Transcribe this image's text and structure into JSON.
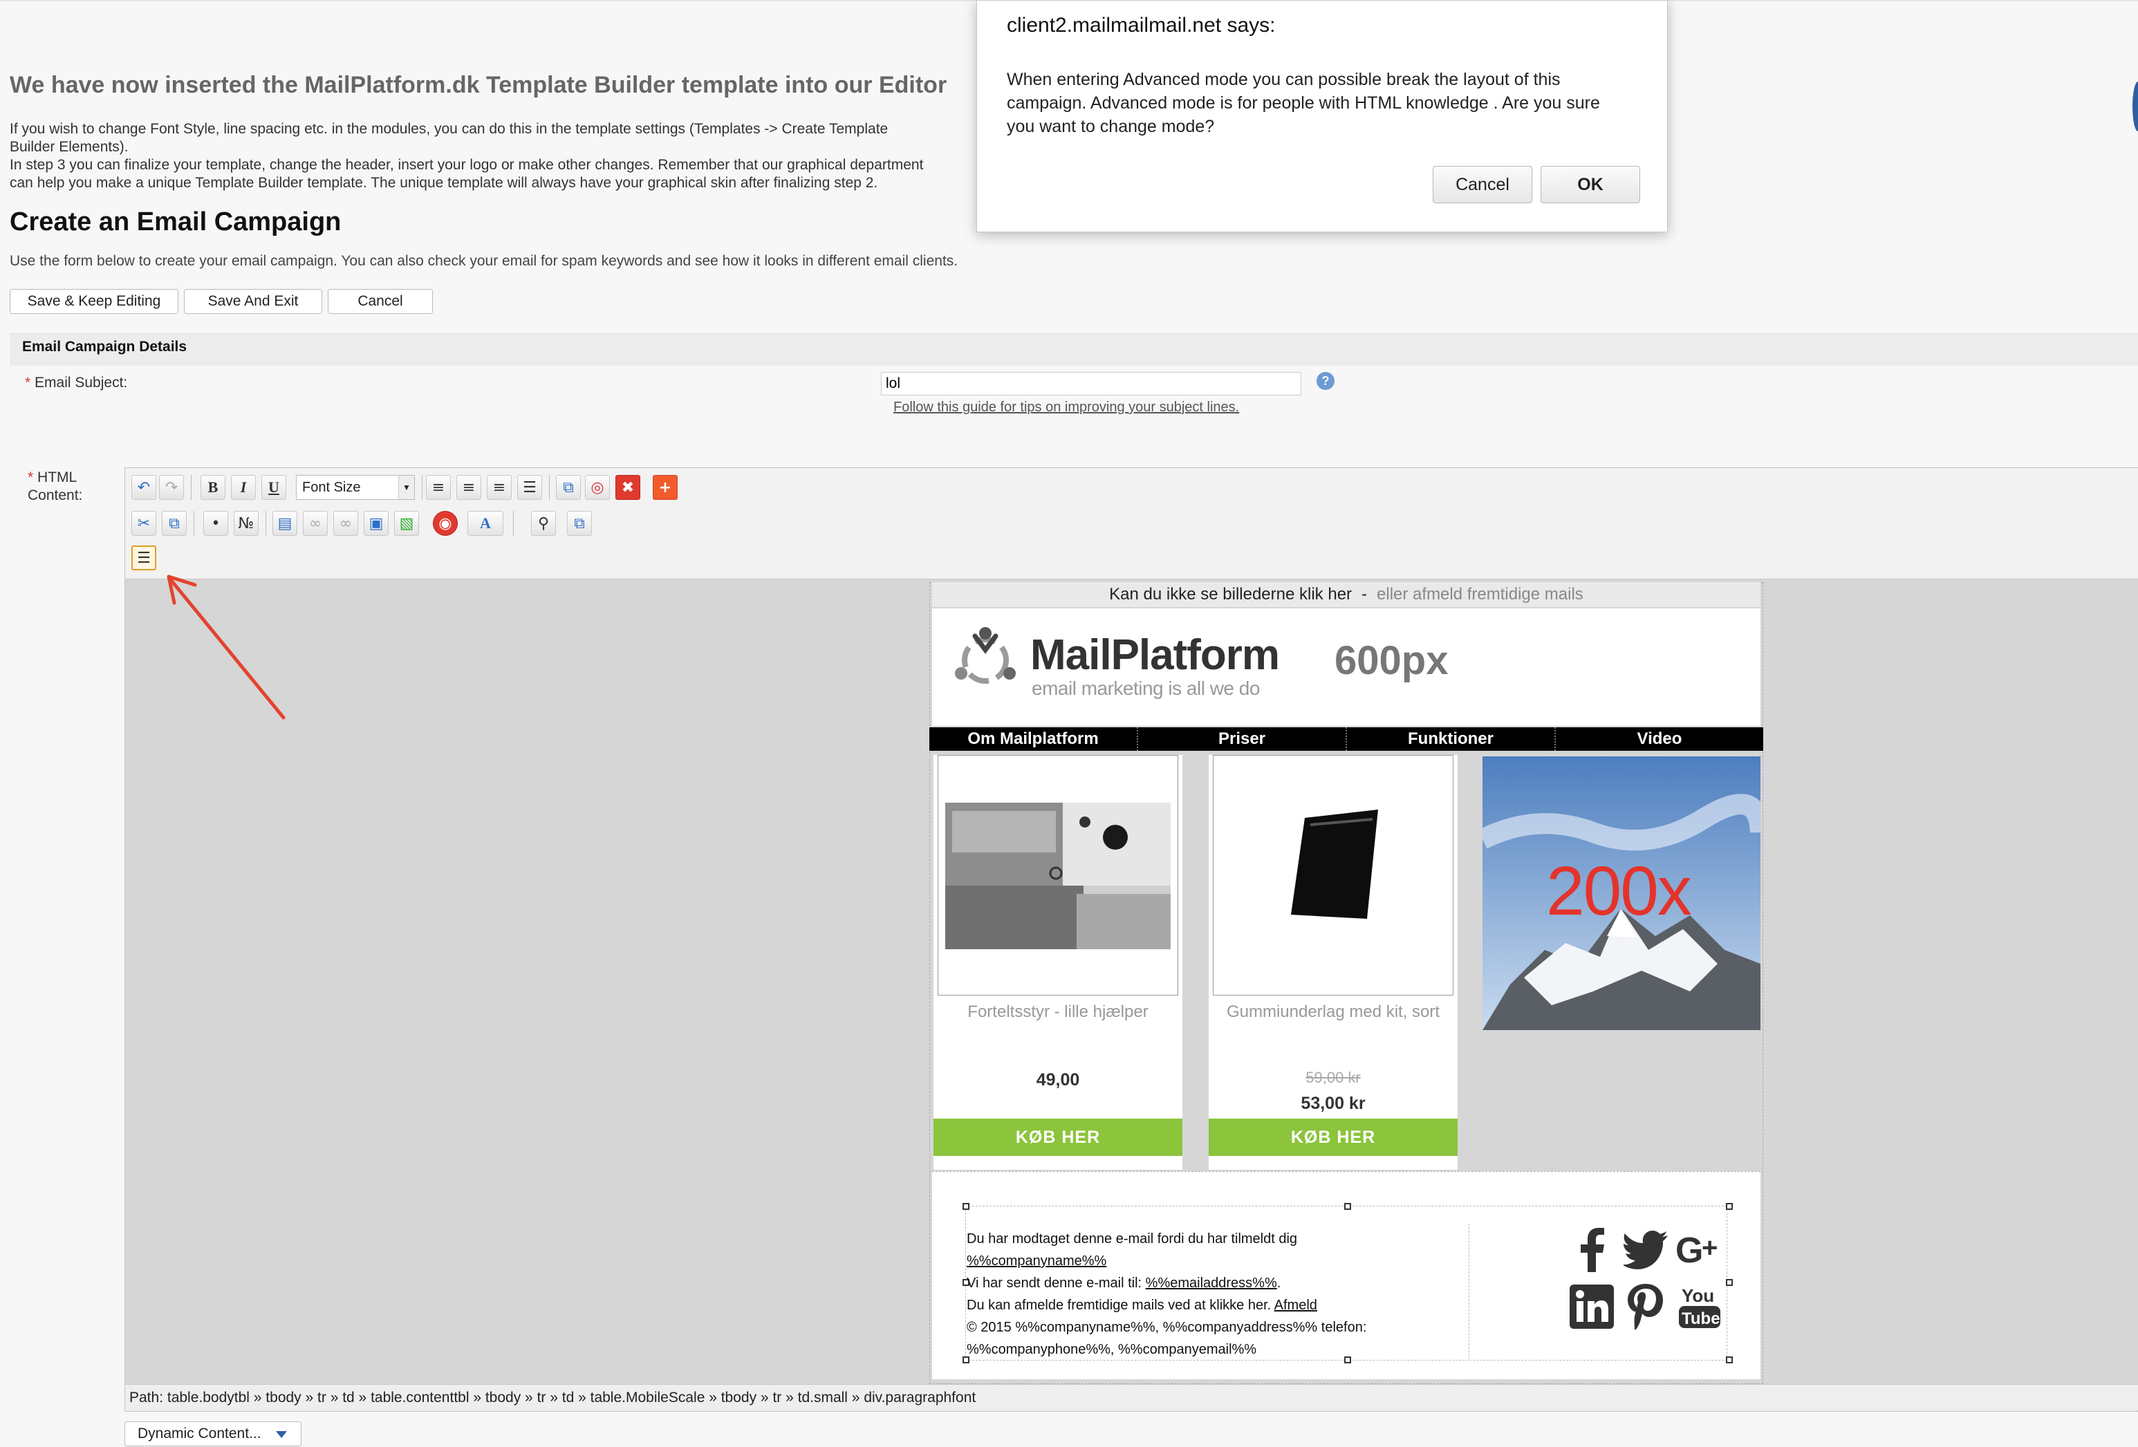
{
  "page": {
    "heading": "We have now inserted the MailPlatform.dk Template Builder template into our Editor",
    "intro_lines": [
      "If you wish to change Font Style, line spacing etc. in the modules, you can do this in the template settings (Templates -> Create Template",
      "Builder Elements).",
      "In step 3 you can finalize your template, change the header, insert your logo or make other changes. Remember that our graphical department",
      "can help you make a unique Template Builder template. The unique template will always have your graphical skin after finalizing step 2."
    ],
    "title": "Create an Email Campaign",
    "subtitle": "Use the form below to create your email campaign. You can also check your email for spam keywords and see how it looks in different email clients."
  },
  "actions": {
    "save_keep": "Save & Keep Editing",
    "save_exit": "Save And Exit",
    "cancel": "Cancel"
  },
  "details": {
    "section_label": "Email Campaign Details",
    "required_mark": "*",
    "subject_label": "Email Subject:",
    "subject_value": "lol",
    "subject_guide": "Follow this guide for tips on improving your subject lines.",
    "help_icon": "?",
    "html_label": "HTML Content:"
  },
  "editor": {
    "font_size_label": "Font Size",
    "path": "Path: table.bodytbl » tbody » tr » td » table.contenttbl » tbody » tr » td » table.MobileScale » tbody » tr » td.small » div.paragraphfont",
    "dynamic_content": "Dynamic Content...",
    "icons": {
      "undo": "undo-icon",
      "redo": "redo-icon",
      "bold": "B",
      "italic": "I",
      "underline": "U",
      "align": [
        "align-left-icon",
        "align-center-icon",
        "align-right-icon",
        "align-justify-icon"
      ],
      "cut": "cut-icon",
      "copy": "copy-icon",
      "bullets": "bulleted-list-icon",
      "numbers": "numbered-list-icon",
      "text_color": "A"
    }
  },
  "email": {
    "preheader_main": "Kan du ikke se billederne klik her",
    "preheader_dash": "-",
    "preheader_muted": "eller afmeld fremtidige mails",
    "logo_text": "MailPlatform",
    "logo_tagline": "email marketing is all we do",
    "header_dim": "600px",
    "nav": [
      "Om Mailplatform",
      "Priser",
      "Funktioner",
      "Video"
    ],
    "products": [
      {
        "name": "Forteltsstyr - lille hjælper",
        "price": "49,00",
        "old_price": "",
        "button": "KØB HER"
      },
      {
        "name": "Gummiunderlag med kit, sort",
        "price": "53,00 kr",
        "old_price": "59,00 kr",
        "button": "KØB HER"
      }
    ],
    "banner_text": "200x",
    "footer_lines": {
      "l1": "Du har modtaget denne e-mail fordi du har tilmeldt dig",
      "l2": "%%companyname%%",
      "l3a": "Vi har sendt denne e-mail til: ",
      "l3b": "%%emailaddress%%",
      "l3c": ".",
      "l4a": "Du kan afmelde fremtidige mails ved at klikke her. ",
      "l4b": "Afmeld",
      "l5": "© 2015 %%companyname%%, %%companyaddress%% telefon:",
      "l6": "%%companyphone%%, %%companyemail%%"
    },
    "social": [
      "facebook-icon",
      "twitter-icon",
      "google-plus-icon",
      "linkedin-icon",
      "pinterest-icon",
      "youtube-icon"
    ],
    "youtube_top": "You",
    "youtube_bottom": "Tube"
  },
  "dialog": {
    "title": "client2.mailmailmail.net says:",
    "message": "When entering Advanced mode you can possible break the layout of this campaign. Advanced mode is for people with HTML knowledge . Are you sure you want to change mode?",
    "cancel": "Cancel",
    "ok": "OK"
  },
  "colors": {
    "buy_button": "#8cc43c",
    "annotation_arrow": "#e4432f",
    "banner_text": "#e4332a",
    "nav_bg": "#000000"
  }
}
